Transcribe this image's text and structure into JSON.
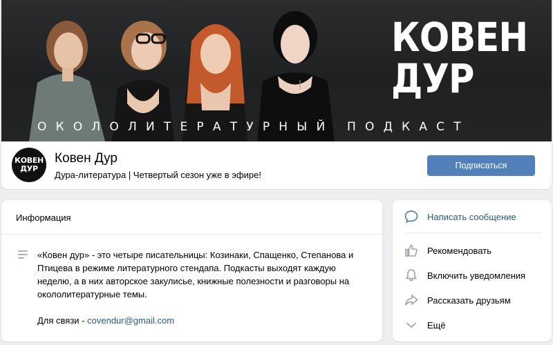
{
  "cover": {
    "title_line1": "КОВЕН",
    "title_line2": "ДУР",
    "subtitle": "ОКОЛОЛИТЕРАТУРНЫЙ ПОДКАСТ"
  },
  "group": {
    "avatar_line1": "КОВЕН",
    "avatar_line2": "ДУР",
    "name": "Ковен Дур",
    "status": "Дура-литература | Четвертый сезон уже в эфире!",
    "subscribe_label": "Подписаться"
  },
  "info": {
    "header": "Информация",
    "description": "«Ковен дур» - это четыре писательницы: Козинаки, Спащенко, Степанова и Птицева в режиме литературного стендапа. Подкасты выходят каждую неделю, а в них авторское закулисье, книжные полезности и разговоры на окололитературные темы.",
    "contact_prefix": "Для связи - ",
    "contact_email": "covendur@gmail.com"
  },
  "actions": {
    "message": "Написать сообщение",
    "recommend": "Рекомендовать",
    "notifications": "Включить уведомления",
    "share": "Рассказать друзьям",
    "more": "Ещё"
  },
  "colors": {
    "accent": "#5181b8",
    "link": "#2a5885",
    "icon": "#99a2ad",
    "page_bg": "#edeef0"
  }
}
